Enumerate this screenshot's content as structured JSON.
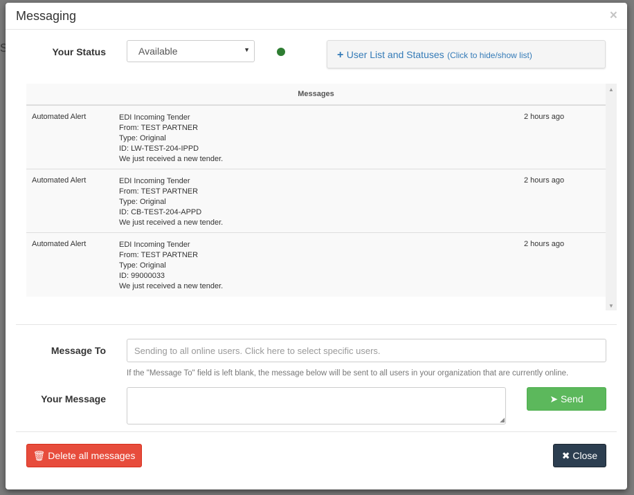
{
  "modal": {
    "title": "Messaging",
    "close_glyph": "×",
    "close_icon": "close-x-icon"
  },
  "status": {
    "label": "Your Status",
    "selected": "Available",
    "indicator_color": "#2e7d32"
  },
  "user_list": {
    "icon": "plus-icon",
    "label": "User List and Statuses",
    "hint": "(Click to hide/show list)"
  },
  "messages": {
    "header": "Messages",
    "rows": [
      {
        "sender": "Automated Alert",
        "lines": [
          "EDI Incoming Tender",
          "From: TEST PARTNER",
          "Type: Original",
          "ID: LW-TEST-204-IPPD",
          "We just received a new tender."
        ],
        "time": "2 hours ago"
      },
      {
        "sender": "Automated Alert",
        "lines": [
          "EDI Incoming Tender",
          "From: TEST PARTNER",
          "Type: Original",
          "ID: CB-TEST-204-APPD",
          "We just received a new tender."
        ],
        "time": "2 hours ago"
      },
      {
        "sender": "Automated Alert",
        "lines": [
          "EDI Incoming Tender",
          "From: TEST PARTNER",
          "Type: Original",
          "ID: 99000033",
          "We just received a new tender."
        ],
        "time": "2 hours ago"
      }
    ]
  },
  "compose": {
    "to_label": "Message To",
    "to_placeholder": "Sending to all online users. Click here to select specific users.",
    "help": "If the \"Message To\" field is left blank, the message below will be sent to all users in your organization that are currently online.",
    "message_label": "Your Message",
    "message_value": "",
    "send_icon": "paper-plane-icon",
    "send_label": "Send"
  },
  "footer": {
    "delete_icon": "trash-icon",
    "delete_label": "Delete all messages",
    "close_icon": "times-icon",
    "close_label": "Close"
  },
  "colors": {
    "link": "#337ab7",
    "send": "#5cb85c",
    "delete": "#e74c3c",
    "close": "#2c3e50"
  }
}
